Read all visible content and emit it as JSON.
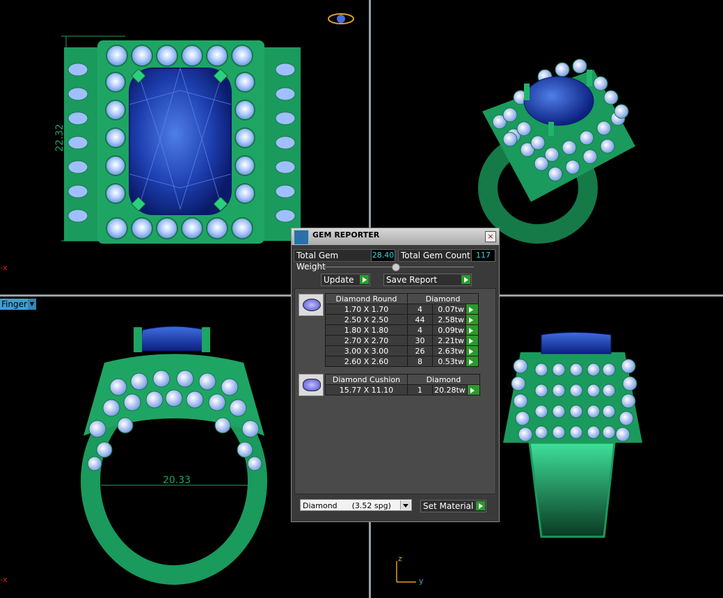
{
  "viewports": {
    "top_dimension": "22.32",
    "front_dimension": "20.33",
    "finger_label": "Finger",
    "axis_label_x": "x",
    "axis_y": "y",
    "axis_z": "z"
  },
  "gem_reporter": {
    "title": "GEM REPORTER",
    "total_weight_label": "Total Gem Weight",
    "total_weight_value": "28.40",
    "total_count_label": "Total Gem Count",
    "total_count_value": "117",
    "update_label": "Update",
    "save_report_label": "Save Report",
    "groups": [
      {
        "shape": "Diamond Round",
        "material": "Diamond",
        "rows": [
          {
            "size": "1.70 X 1.70",
            "count": "4",
            "weight": "0.07tw"
          },
          {
            "size": "2.50 X 2.50",
            "count": "44",
            "weight": "2.58tw"
          },
          {
            "size": "1.80 X 1.80",
            "count": "4",
            "weight": "0.09tw"
          },
          {
            "size": "2.70 X 2.70",
            "count": "30",
            "weight": "2.21tw"
          },
          {
            "size": "3.00 X 3.00",
            "count": "26",
            "weight": "2.63tw"
          },
          {
            "size": "2.60 X 2.60",
            "count": "8",
            "weight": "0.53tw"
          }
        ]
      },
      {
        "shape": "Diamond Cushion",
        "material": "Diamond",
        "rows": [
          {
            "size": "15.77 X 11.10",
            "count": "1",
            "weight": "20.28tw"
          }
        ]
      }
    ],
    "material_select": "Diamond      (3.52 spg)",
    "set_material_label": "Set Material"
  },
  "colors": {
    "metal": "#1a9a5c",
    "diamond": "#a8c8ff",
    "sapphire": "#1e3fb0",
    "value_text": "#31d6e0"
  }
}
